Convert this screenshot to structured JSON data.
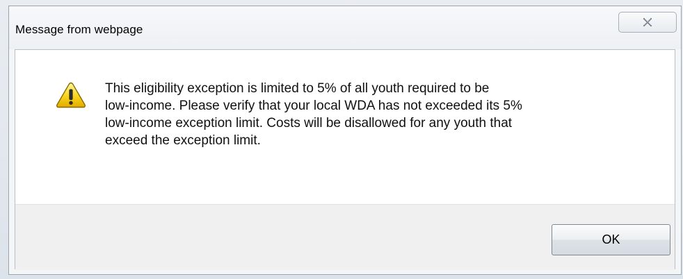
{
  "dialog": {
    "title": "Message from webpage",
    "message": "This eligibility exception is limited to 5% of all youth required to be\nlow-income. Please verify that your local WDA has not exceeded its 5%\nlow-income exception limit. Costs will be disallowed for any youth that\nexceed the exception limit.",
    "ok_label": "OK",
    "icon": "warning-icon"
  },
  "colors": {
    "warning_yellow": "#f5c400",
    "warning_outline": "#8a6a00",
    "dialog_bg": "#f3f5f7",
    "footer_bg": "#f0f0f0"
  }
}
